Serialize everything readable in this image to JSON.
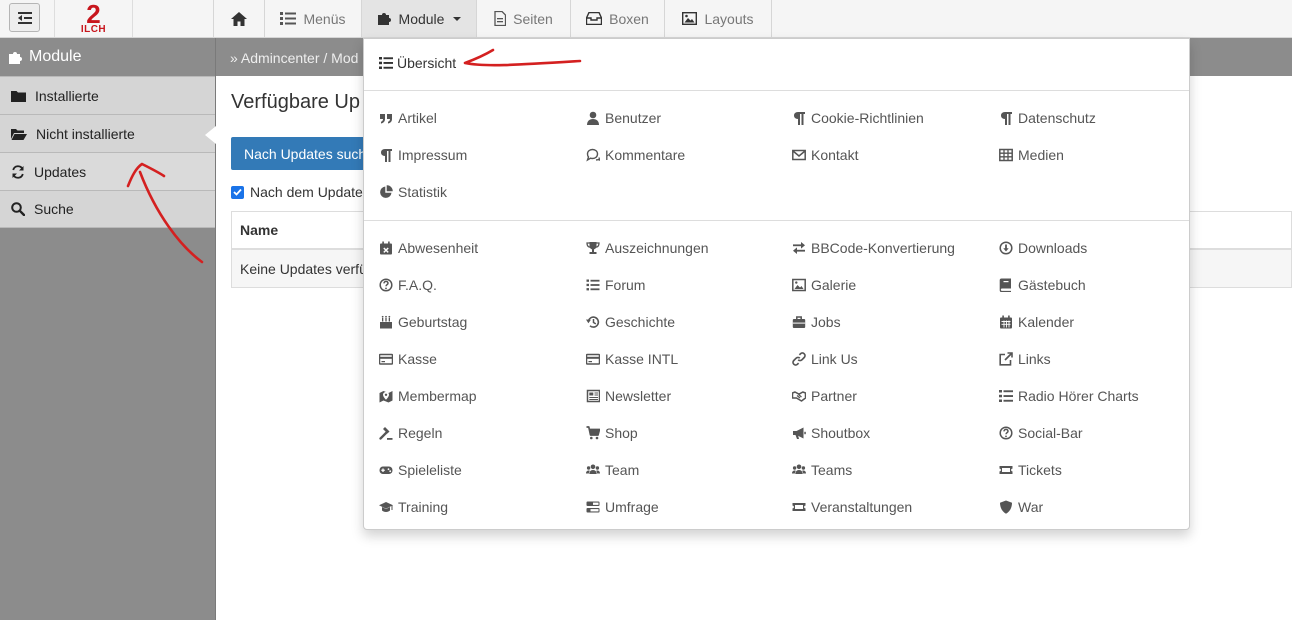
{
  "logo": {
    "number": "2",
    "text": "ILCH"
  },
  "nav": {
    "menus": "Menüs",
    "module": "Module",
    "seiten": "Seiten",
    "boxen": "Boxen",
    "layouts": "Layouts"
  },
  "sidebar": {
    "title": "Module",
    "items": [
      {
        "label": "Installierte",
        "icon": "folder-icon"
      },
      {
        "label": "Nicht installierte",
        "icon": "folder-open-icon"
      },
      {
        "label": "Updates",
        "icon": "refresh-icon"
      },
      {
        "label": "Suche",
        "icon": "search-icon"
      }
    ]
  },
  "breadcrumb": {
    "text": "» Admincenter /  Mod"
  },
  "content": {
    "title": "Verfügbare Up",
    "button": "Nach Updates such",
    "checkbox_label": "Nach dem Update",
    "table": {
      "header": "Name",
      "empty": "Keine Updates verfü"
    }
  },
  "dropdown": {
    "overview": "Übersicht",
    "group1": [
      {
        "label": "Artikel",
        "icon": "quote-icon"
      },
      {
        "label": "Benutzer",
        "icon": "user-icon"
      },
      {
        "label": "Cookie-Richtlinien",
        "icon": "paragraph-icon"
      },
      {
        "label": "Datenschutz",
        "icon": "paragraph-icon"
      },
      {
        "label": "Impressum",
        "icon": "paragraph-icon"
      },
      {
        "label": "Kommentare",
        "icon": "comments-icon"
      },
      {
        "label": "Kontakt",
        "icon": "envelope-icon"
      },
      {
        "label": "Medien",
        "icon": "table-icon"
      },
      {
        "label": "Statistik",
        "icon": "pie-chart-icon"
      }
    ],
    "group2": [
      {
        "label": "Abwesenheit",
        "icon": "calendar-x-icon"
      },
      {
        "label": "Auszeichnungen",
        "icon": "trophy-icon"
      },
      {
        "label": "BBCode-Konvertierung",
        "icon": "exchange-icon"
      },
      {
        "label": "Downloads",
        "icon": "download-icon"
      },
      {
        "label": "F.A.Q.",
        "icon": "question-circle-icon"
      },
      {
        "label": "Forum",
        "icon": "list-icon"
      },
      {
        "label": "Galerie",
        "icon": "image-icon"
      },
      {
        "label": "Gästebuch",
        "icon": "book-icon"
      },
      {
        "label": "Geburtstag",
        "icon": "cake-icon"
      },
      {
        "label": "Geschichte",
        "icon": "history-icon"
      },
      {
        "label": "Jobs",
        "icon": "briefcase-icon"
      },
      {
        "label": "Kalender",
        "icon": "calendar-icon"
      },
      {
        "label": "Kasse",
        "icon": "credit-card-icon"
      },
      {
        "label": "Kasse INTL",
        "icon": "credit-card-icon"
      },
      {
        "label": "Link Us",
        "icon": "link-icon"
      },
      {
        "label": "Links",
        "icon": "external-link-icon"
      },
      {
        "label": "Membermap",
        "icon": "map-marker-icon"
      },
      {
        "label": "Newsletter",
        "icon": "newspaper-icon"
      },
      {
        "label": "Partner",
        "icon": "handshake-icon"
      },
      {
        "label": "Radio Hörer Charts",
        "icon": "list-ol-icon"
      },
      {
        "label": "Regeln",
        "icon": "gavel-icon"
      },
      {
        "label": "Shop",
        "icon": "cart-icon"
      },
      {
        "label": "Shoutbox",
        "icon": "bullhorn-icon"
      },
      {
        "label": "Social-Bar",
        "icon": "question-circle-icon"
      },
      {
        "label": "Spieleliste",
        "icon": "gamepad-icon"
      },
      {
        "label": "Team",
        "icon": "users-icon"
      },
      {
        "label": "Teams",
        "icon": "users-icon"
      },
      {
        "label": "Tickets",
        "icon": "ticket-icon"
      },
      {
        "label": "Training",
        "icon": "graduation-cap-icon"
      },
      {
        "label": "Umfrage",
        "icon": "poll-icon"
      },
      {
        "label": "Veranstaltungen",
        "icon": "ticket-icon"
      },
      {
        "label": "War",
        "icon": "shield-icon"
      }
    ]
  },
  "colors": {
    "primary": "#337ab7",
    "sidebar": "#8c8c8c",
    "annotation": "#d42020"
  }
}
